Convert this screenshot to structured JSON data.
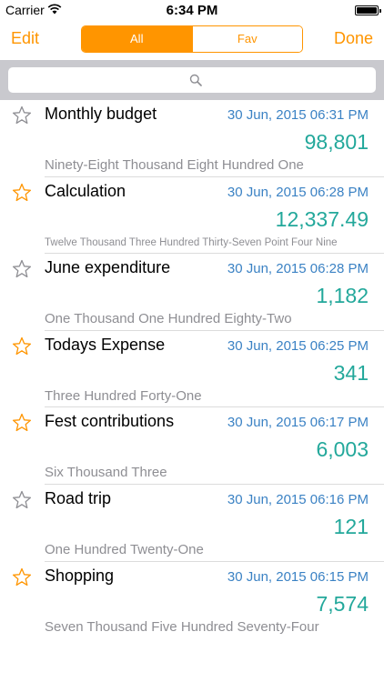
{
  "status": {
    "carrier": "Carrier",
    "time": "6:34 PM"
  },
  "nav": {
    "edit_label": "Edit",
    "done_label": "Done",
    "segments": [
      {
        "label": "All",
        "selected": true
      },
      {
        "label": "Fav",
        "selected": false
      }
    ],
    "accent_color": "#ff9500"
  },
  "search": {
    "placeholder": "",
    "icon": "search-icon"
  },
  "items": [
    {
      "title": "Monthly budget",
      "date": "30 Jun, 2015 06:31 PM",
      "amount": "98,801",
      "words": "Ninety-Eight Thousand Eight Hundred One",
      "favorite": false
    },
    {
      "title": "Calculation",
      "date": "30 Jun, 2015 06:28 PM",
      "amount": "12,337.49",
      "words": "Twelve Thousand Three Hundred Thirty-Seven Point Four Nine",
      "favorite": true
    },
    {
      "title": "June expenditure",
      "date": "30 Jun, 2015 06:28 PM",
      "amount": "1,182",
      "words": "One Thousand One Hundred Eighty-Two",
      "favorite": false
    },
    {
      "title": "Todays Expense",
      "date": "30 Jun, 2015 06:25 PM",
      "amount": "341",
      "words": "Three Hundred Forty-One",
      "favorite": true
    },
    {
      "title": "Fest contributions",
      "date": "30 Jun, 2015 06:17 PM",
      "amount": "6,003",
      "words": "Six Thousand Three",
      "favorite": true
    },
    {
      "title": "Road trip",
      "date": "30 Jun, 2015 06:16 PM",
      "amount": "121",
      "words": "One Hundred Twenty-One",
      "favorite": false
    },
    {
      "title": "Shopping",
      "date": "30 Jun, 2015 06:15 PM",
      "amount": "7,574",
      "words": "Seven Thousand Five Hundred Seventy-Four",
      "favorite": true
    }
  ]
}
